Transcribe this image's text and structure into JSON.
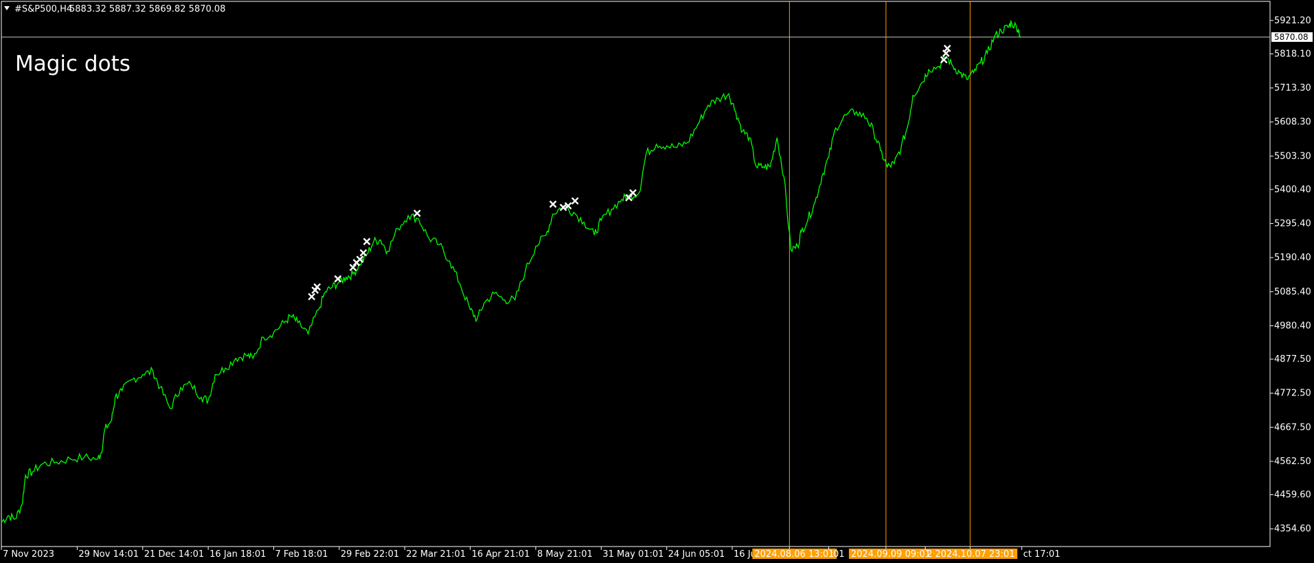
{
  "header": {
    "symbol": "#S&P500,H4",
    "ohlc": "5883.32 5887.32 5869.82 5870.08"
  },
  "indicator_title": "Magic dots",
  "current_price": "5870.08",
  "colors": {
    "background": "#000000",
    "frame": "#ffffff",
    "price_line": "#00ff00",
    "marker": "#ffffff",
    "vertical_line": "#ffa000",
    "label_bg": "#ffa000"
  },
  "chart_data": {
    "type": "line",
    "title": "",
    "xlabel": "",
    "ylabel": "",
    "ylim": [
      4300,
      5980
    ],
    "y_ticks": [
      "5921.20",
      "5818.10",
      "5713.30",
      "5608.30",
      "5503.30",
      "5400.40",
      "5295.40",
      "5190.40",
      "5085.40",
      "4980.40",
      "4877.50",
      "4772.50",
      "4667.50",
      "4562.50",
      "4459.60",
      "4354.60"
    ],
    "x_labels": [
      "7 Nov 2023",
      "29 Nov 14:01",
      "21 Dec 14:01",
      "16 Jan 18:01",
      "7 Feb 18:01",
      "29 Feb 22:01",
      "22 Mar 21:01",
      "16 Apr 21:01",
      "8 May 21:01",
      "31 May 01:01",
      "24 Jun 05:01",
      "16 Jul",
      "2024.08.06 13:01",
      ":01",
      "2024.09.09 09:01",
      "20",
      "2024.10.07 23:01",
      "ct 17:01"
    ],
    "x_ticks": [
      0,
      110,
      205,
      300,
      395,
      490,
      585,
      680,
      775,
      870,
      965,
      1060,
      1143,
      1200,
      1283,
      1340,
      1405,
      1480
    ],
    "x_extent": [
      0,
      1840
    ],
    "vertical_lines": [
      {
        "x": 1143,
        "label": "2024.08.06 13:01"
      },
      {
        "x": 1283,
        "label": "2024.09.09 09:01"
      },
      {
        "x": 1405,
        "label": "2024.10.07 23:01"
      }
    ],
    "series": [
      {
        "points": [
          [
            0,
            4375
          ],
          [
            10,
            4395
          ],
          [
            20,
            4385
          ],
          [
            30,
            4430
          ],
          [
            35,
            4520
          ],
          [
            45,
            4530
          ],
          [
            60,
            4555
          ],
          [
            80,
            4560
          ],
          [
            100,
            4570
          ],
          [
            120,
            4575
          ],
          [
            140,
            4570
          ],
          [
            145,
            4590
          ],
          [
            150,
            4660
          ],
          [
            160,
            4690
          ],
          [
            165,
            4760
          ],
          [
            175,
            4780
          ],
          [
            190,
            4815
          ],
          [
            205,
            4830
          ],
          [
            220,
            4840
          ],
          [
            230,
            4790
          ],
          [
            245,
            4725
          ],
          [
            260,
            4790
          ],
          [
            275,
            4800
          ],
          [
            290,
            4760
          ],
          [
            300,
            4750
          ],
          [
            310,
            4830
          ],
          [
            325,
            4850
          ],
          [
            340,
            4880
          ],
          [
            355,
            4890
          ],
          [
            365,
            4880
          ],
          [
            380,
            4945
          ],
          [
            395,
            4960
          ],
          [
            410,
            4990
          ],
          [
            420,
            5010
          ],
          [
            430,
            4990
          ],
          [
            445,
            4955
          ],
          [
            460,
            5030
          ],
          [
            470,
            5085
          ],
          [
            480,
            5100
          ],
          [
            490,
            5115
          ],
          [
            500,
            5130
          ],
          [
            510,
            5140
          ],
          [
            520,
            5170
          ],
          [
            530,
            5200
          ],
          [
            540,
            5240
          ],
          [
            550,
            5245
          ],
          [
            560,
            5210
          ],
          [
            575,
            5280
          ],
          [
            590,
            5320
          ],
          [
            605,
            5310
          ],
          [
            620,
            5250
          ],
          [
            635,
            5230
          ],
          [
            650,
            5180
          ],
          [
            665,
            5110
          ],
          [
            680,
            5030
          ],
          [
            690,
            5000
          ],
          [
            700,
            5050
          ],
          [
            715,
            5080
          ],
          [
            730,
            5060
          ],
          [
            745,
            5060
          ],
          [
            760,
            5150
          ],
          [
            775,
            5225
          ],
          [
            790,
            5260
          ],
          [
            800,
            5325
          ],
          [
            815,
            5350
          ],
          [
            830,
            5330
          ],
          [
            845,
            5300
          ],
          [
            860,
            5260
          ],
          [
            870,
            5305
          ],
          [
            885,
            5340
          ],
          [
            900,
            5370
          ],
          [
            910,
            5380
          ],
          [
            925,
            5390
          ],
          [
            935,
            5510
          ],
          [
            950,
            5540
          ],
          [
            965,
            5535
          ],
          [
            980,
            5530
          ],
          [
            995,
            5545
          ],
          [
            1010,
            5600
          ],
          [
            1025,
            5660
          ],
          [
            1040,
            5680
          ],
          [
            1055,
            5695
          ],
          [
            1065,
            5640
          ],
          [
            1075,
            5580
          ],
          [
            1085,
            5560
          ],
          [
            1095,
            5470
          ],
          [
            1105,
            5470
          ],
          [
            1115,
            5470
          ],
          [
            1125,
            5560
          ],
          [
            1135,
            5440
          ],
          [
            1145,
            5215
          ],
          [
            1155,
            5225
          ],
          [
            1160,
            5270
          ],
          [
            1170,
            5310
          ],
          [
            1180,
            5360
          ],
          [
            1190,
            5440
          ],
          [
            1200,
            5500
          ],
          [
            1210,
            5590
          ],
          [
            1225,
            5630
          ],
          [
            1240,
            5640
          ],
          [
            1255,
            5620
          ],
          [
            1265,
            5580
          ],
          [
            1275,
            5520
          ],
          [
            1285,
            5470
          ],
          [
            1295,
            5480
          ],
          [
            1305,
            5530
          ],
          [
            1315,
            5600
          ],
          [
            1322,
            5690
          ],
          [
            1335,
            5730
          ],
          [
            1345,
            5770
          ],
          [
            1360,
            5780
          ],
          [
            1370,
            5810
          ],
          [
            1380,
            5780
          ],
          [
            1390,
            5760
          ],
          [
            1400,
            5740
          ],
          [
            1410,
            5760
          ],
          [
            1420,
            5790
          ],
          [
            1430,
            5820
          ],
          [
            1440,
            5870
          ],
          [
            1450,
            5890
          ],
          [
            1460,
            5900
          ],
          [
            1465,
            5915
          ],
          [
            1475,
            5895
          ],
          [
            1478,
            5870
          ]
        ]
      }
    ],
    "markers_x": [
      [
        450,
        5070
      ],
      [
        455,
        5090
      ],
      [
        458,
        5100
      ],
      [
        488,
        5125
      ],
      [
        510,
        5160
      ],
      [
        515,
        5175
      ],
      [
        520,
        5185
      ],
      [
        525,
        5205
      ],
      [
        530,
        5240
      ],
      [
        603,
        5327
      ],
      [
        800,
        5355
      ],
      [
        815,
        5345
      ],
      [
        822,
        5350
      ],
      [
        832,
        5365
      ],
      [
        910,
        5375
      ],
      [
        916,
        5390
      ],
      [
        1367,
        5800
      ],
      [
        1370,
        5820
      ],
      [
        1372,
        5835
      ]
    ]
  }
}
